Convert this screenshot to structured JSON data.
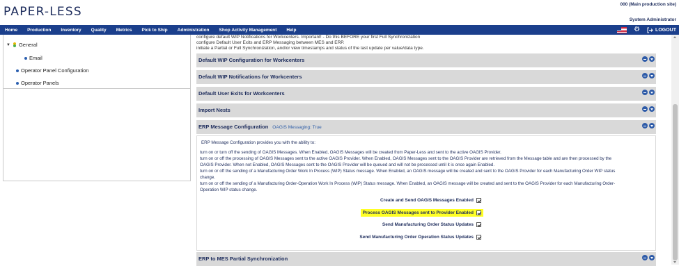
{
  "app": {
    "logo": "PAPER-LESS",
    "site": "000 (Main production site)",
    "user": "System Administrator"
  },
  "nav": {
    "items": [
      "Home",
      "Production",
      "Inventory",
      "Quality",
      "Metrics",
      "Pick to Ship",
      "Administration",
      "Shop Activity Management",
      "Help"
    ],
    "logout": "LOGOUT",
    "bar_color": "#1b3f8c"
  },
  "tree": {
    "general": "General",
    "email": "Email",
    "operator_panel_configuration": "Operator Panel Configuration",
    "operator_panels": "Operator Panels"
  },
  "intro": [
    "configure default WIP Notifications for Workcenters. Important! - Do this BEFORE your first Full Synchronization",
    "configure Default User Exits and ERP Messaging between MES and ERP.",
    "initiate a Partial or Full Synchronization, and/or view timestamps and status of the last update per value/data type."
  ],
  "sections": {
    "wip_config": "Default WIP Configuration for Workcenters",
    "wip_notifications": "Default WIP Notifications for Workcenters",
    "user_exits": "Default User Exits for Workcenters",
    "import_nests": "Import Nests",
    "erp_message": "ERP Message Configuration",
    "erp_message_status": "OAGIS Messaging: True",
    "erp_sync": "ERP to MES Partial Synchronization"
  },
  "panel": {
    "lead": "ERP Message Configuration provides you with the ability to:",
    "lines": [
      "turn on or turn off the sending of OAGIS Messages. When Enabled, OAGIS Messages will be created from Paper-Less and sent to the active OAGIS Provider.",
      "turn on or off the processing of OAGIS Messages sent to the active OAGIS Provider. When Enabled, OAGIS Messages sent to the OAGIS Provider are retrieved from the Message table and are then processed by the",
      "OAGIS Provider. When not Enabled, OAGIS Messages sent to the OAGIS Provider will be queued and will not be processed until it is once again Enabled.",
      "turn on or off the sending of a Manufacturing Order Work In Process (WIP) Status message. When Enabled, an OAGIS message will be created and sent to the OAGIS Provider for each Manufacturing Order WIP status",
      "change.",
      "turn on or off the sending of a Manufacturing Order-Operation Work In Process (WIP) Status message. When Enabled, an OAGIS message will be created and sent to the OAGIS Provider for each Manufacturing Order-",
      "Operation WIP status change."
    ],
    "checks": [
      {
        "label": "Create and Send OAGIS Messages Enabled",
        "checked": true
      },
      {
        "label": "Process OAGIS Messages sent to Provider Enabled",
        "checked": true,
        "highlight": "#ffff26"
      },
      {
        "label": "Send Manufacturing Order Status Updates",
        "checked": true
      },
      {
        "label": "Send Manufacturing Order Operation Status Updates",
        "checked": true
      }
    ]
  }
}
